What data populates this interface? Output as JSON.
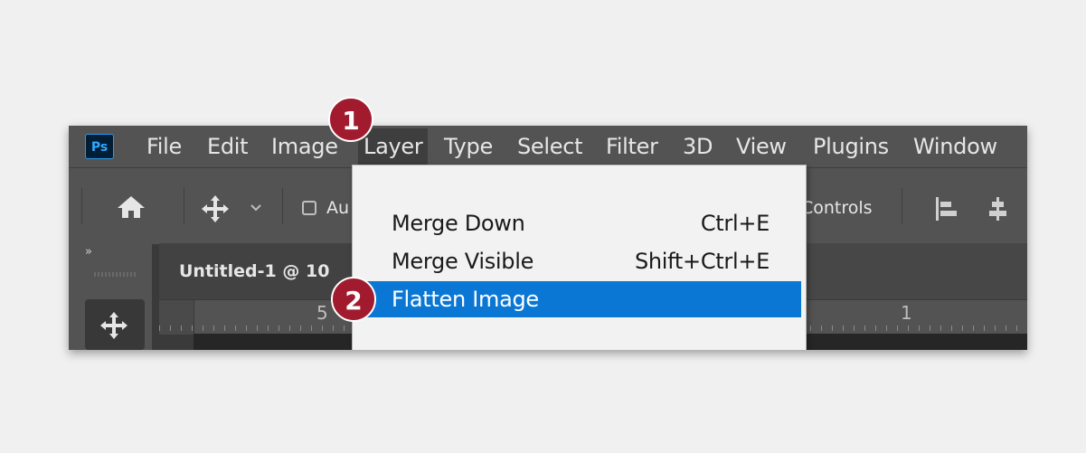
{
  "app": {
    "logo_text": "Ps"
  },
  "menubar": {
    "items": [
      "File",
      "Edit",
      "Image",
      "Layer",
      "Type",
      "Select",
      "Filter",
      "3D",
      "View",
      "Plugins",
      "Window"
    ]
  },
  "optionsbar": {
    "auto_select_label_partial": "Au",
    "controls_label_partial": "Controls"
  },
  "document": {
    "tab_title_partial": "Untitled-1 @ 10"
  },
  "ruler": {
    "labels": [
      "5",
      "1"
    ]
  },
  "layer_menu": {
    "items": [
      {
        "label": "Merge Down",
        "shortcut": "Ctrl+E"
      },
      {
        "label": "Merge Visible",
        "shortcut": "Shift+Ctrl+E"
      },
      {
        "label": "Flatten Image",
        "shortcut": ""
      }
    ],
    "highlighted": "Flatten Image"
  },
  "callouts": [
    "1",
    "2"
  ],
  "colors": {
    "page_bg": "#f0f0f0",
    "ui_bg": "#535353",
    "menu_highlight": "#0a77d4",
    "callout": "#a11a2e"
  }
}
